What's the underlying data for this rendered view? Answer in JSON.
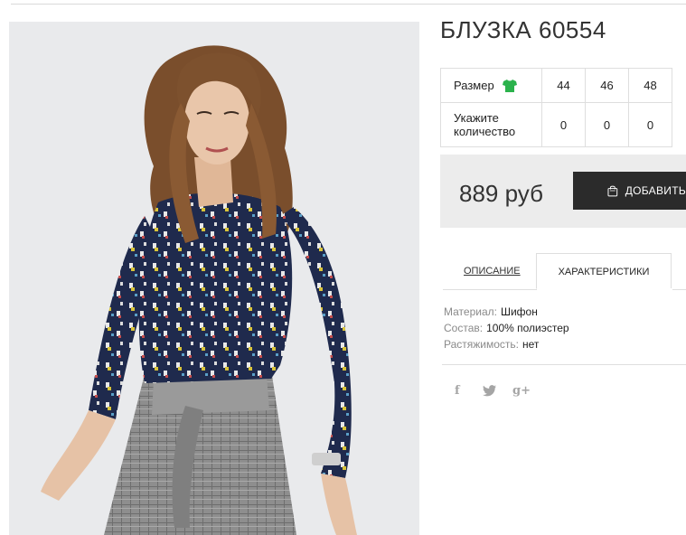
{
  "product": {
    "title": "БЛУЗКА 60554",
    "image_alt": "photo of model wearing navy printed blouse"
  },
  "size_table": {
    "size_label": "Размер",
    "sizes": [
      "44",
      "46",
      "48"
    ],
    "qty_label_line1": "Укажите",
    "qty_label_line2": "количество",
    "quantities": [
      "0",
      "0",
      "0"
    ],
    "size_icon": "shirt-icon",
    "icon_color": "#2bb24c"
  },
  "purchase": {
    "price": "889 руб",
    "buy_label": "ДОБАВИТЬ",
    "buy_icon": "shopping-bag-icon"
  },
  "tabs": {
    "description": "ОПИСАНИЕ",
    "specs": "ХАРАКТЕРИСТИКИ",
    "active": "specs"
  },
  "specs": [
    {
      "key": "Материал:",
      "value": "Шифон"
    },
    {
      "key": "Состав:",
      "value": "100% полиэстер"
    },
    {
      "key": "Растяжимость:",
      "value": "нет"
    }
  ],
  "social": {
    "facebook": "f",
    "twitter_icon": "twitter-bird-icon",
    "googleplus": "g+"
  },
  "colors": {
    "button_bg": "#2b2b2b",
    "price_bg": "#ececec",
    "blouse": "#1f2a4d",
    "skirt": "#8c8c8c"
  }
}
